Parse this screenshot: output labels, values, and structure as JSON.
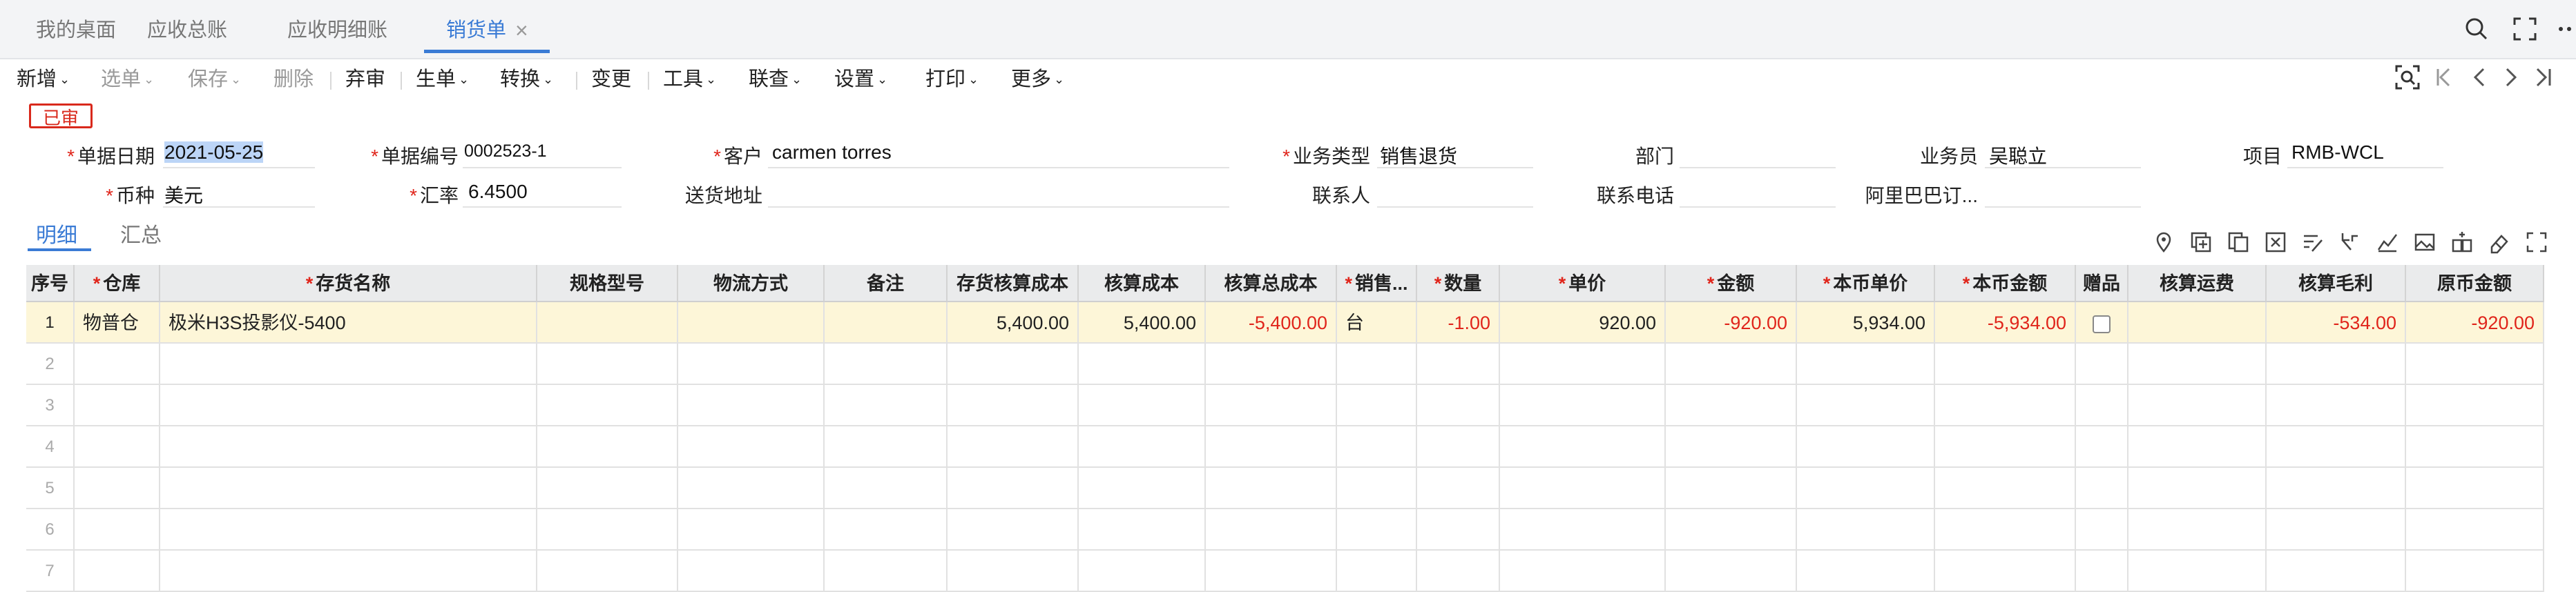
{
  "tabs": [
    {
      "label": "我的桌面",
      "active": false
    },
    {
      "label": "应收总账",
      "active": false
    },
    {
      "label": "应收明细账",
      "active": false
    },
    {
      "label": "销货单",
      "active": true
    }
  ],
  "tab_close": "×",
  "toolbar": {
    "items": [
      {
        "label": "新增",
        "dropdown": true,
        "disabled": false
      },
      {
        "label": "选单",
        "dropdown": true,
        "disabled": true
      },
      {
        "label": "保存",
        "dropdown": true,
        "disabled": true
      },
      {
        "label": "删除",
        "dropdown": false,
        "disabled": true
      },
      {
        "label": "弃审",
        "dropdown": false,
        "disabled": false
      },
      {
        "label": "生单",
        "dropdown": true,
        "disabled": false
      },
      {
        "label": "转换",
        "dropdown": true,
        "disabled": false
      },
      {
        "label": "变更",
        "dropdown": false,
        "disabled": false
      },
      {
        "label": "工具",
        "dropdown": true,
        "disabled": false
      },
      {
        "label": "联查",
        "dropdown": true,
        "disabled": false
      },
      {
        "label": "设置",
        "dropdown": true,
        "disabled": false
      },
      {
        "label": "打印",
        "dropdown": true,
        "disabled": false
      },
      {
        "label": "更多",
        "dropdown": true,
        "disabled": false
      }
    ],
    "caret": "⌄"
  },
  "status_badge": "已审",
  "form": {
    "doc_date": {
      "label": "单据日期",
      "value": "2021-05-25",
      "required": true
    },
    "doc_no": {
      "label": "单据编号",
      "value": "0002523-1",
      "required": true
    },
    "customer": {
      "label": "客户",
      "value": "carmen torres",
      "required": true
    },
    "biz_type": {
      "label": "业务类型",
      "value": "销售退货",
      "required": true
    },
    "department": {
      "label": "部门",
      "value": ""
    },
    "salesman": {
      "label": "业务员",
      "value": "吴聪立"
    },
    "project": {
      "label": "项目",
      "value": "RMB-WCL"
    },
    "currency": {
      "label": "币种",
      "value": "美元",
      "required": true
    },
    "exchange_rate": {
      "label": "汇率",
      "value": "6.4500",
      "required": true
    },
    "ship_address": {
      "label": "送货地址",
      "value": ""
    },
    "contact": {
      "label": "联系人",
      "value": ""
    },
    "phone": {
      "label": "联系电话",
      "value": ""
    },
    "alibaba": {
      "label": "阿里巴巴订...",
      "value": ""
    },
    "required_mark": "*"
  },
  "subtabs": [
    {
      "label": "明细",
      "active": true
    },
    {
      "label": "汇总",
      "active": false
    }
  ],
  "grid": {
    "columns": [
      {
        "key": "seq",
        "label": "序号",
        "required": false
      },
      {
        "key": "warehouse",
        "label": "仓库",
        "required": true
      },
      {
        "key": "item",
        "label": "存货名称",
        "required": true
      },
      {
        "key": "spec",
        "label": "规格型号",
        "required": false
      },
      {
        "key": "logistics",
        "label": "物流方式",
        "required": false
      },
      {
        "key": "remark",
        "label": "备注",
        "required": false
      },
      {
        "key": "inv_cost",
        "label": "存货核算成本",
        "required": false
      },
      {
        "key": "cost",
        "label": "核算成本",
        "required": false
      },
      {
        "key": "total_cost",
        "label": "核算总成本",
        "required": false
      },
      {
        "key": "unit",
        "label": "销售...",
        "required": true
      },
      {
        "key": "qty",
        "label": "数量",
        "required": true
      },
      {
        "key": "price",
        "label": "单价",
        "required": true
      },
      {
        "key": "amount",
        "label": "金额",
        "required": true
      },
      {
        "key": "local_price",
        "label": "本币单价",
        "required": true
      },
      {
        "key": "local_amount",
        "label": "本币金额",
        "required": true
      },
      {
        "key": "gift",
        "label": "赠品",
        "required": false
      },
      {
        "key": "freight",
        "label": "核算运费",
        "required": false
      },
      {
        "key": "gross_profit",
        "label": "核算毛利",
        "required": false
      },
      {
        "key": "orig_amount",
        "label": "原币金额",
        "required": false
      }
    ],
    "rows": [
      {
        "seq": "1",
        "warehouse": "物普仓",
        "item": "极米H3S投影仪-5400",
        "spec": "",
        "logistics": "",
        "remark": "",
        "inv_cost": "5,400.00",
        "cost": "5,400.00",
        "total_cost": "-5,400.00",
        "unit": "台",
        "qty": "-1.00",
        "price": "920.00",
        "amount": "-920.00",
        "local_price": "5,934.00",
        "local_amount": "-5,934.00",
        "gift": false,
        "freight": "",
        "gross_profit": "-534.00",
        "orig_amount": "-920.00"
      },
      {
        "seq": "2"
      },
      {
        "seq": "3"
      },
      {
        "seq": "4"
      },
      {
        "seq": "5"
      },
      {
        "seq": "6"
      },
      {
        "seq": "7"
      }
    ]
  },
  "colors": {
    "accent": "#3a7bd5",
    "negative": "#e0251b",
    "highlight_row": "#fdf6d8",
    "badge": "#d9291c"
  }
}
